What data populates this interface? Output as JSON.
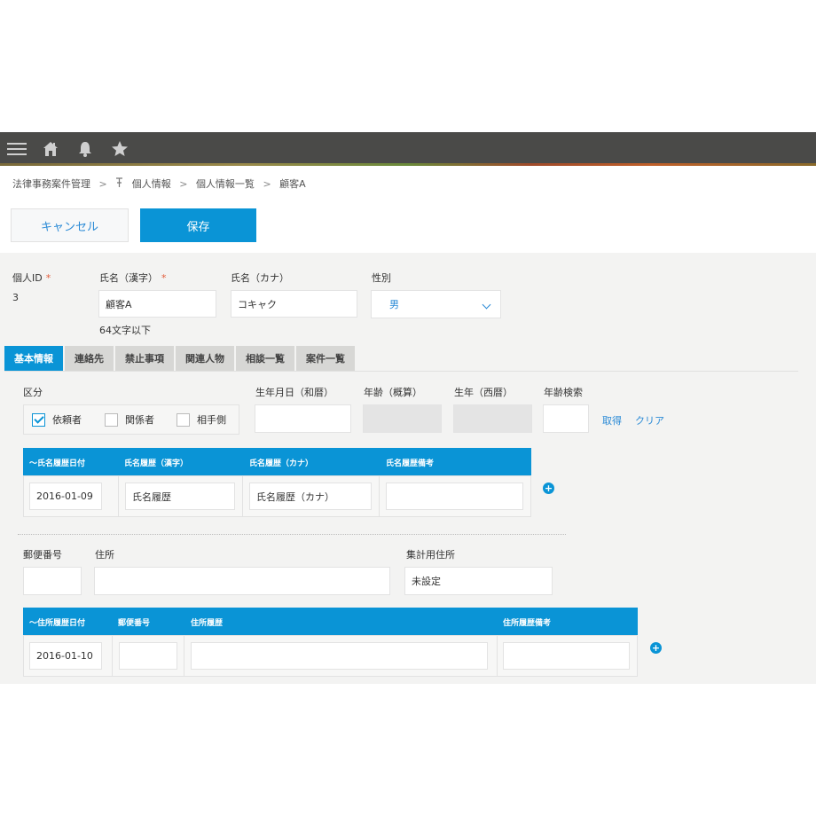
{
  "breadcrumb": {
    "app": "法律事務案件管理",
    "space": "個人情報",
    "view": "個人情報一覧",
    "record": "顧客A",
    "sep": ">"
  },
  "actions": {
    "cancel": "キャンセル",
    "save": "保存"
  },
  "header_fields": {
    "personal_id_label": "個人ID",
    "personal_id_value": "3",
    "required_mark": "*",
    "name_kanji_label": "氏名（漢字）",
    "name_kanji_value": "顧客A",
    "name_kanji_hint": "64文字以下",
    "name_kana_label": "氏名（カナ）",
    "name_kana_value": "コキャク",
    "gender_label": "性別",
    "gender_value": "男"
  },
  "tabs": [
    "基本情報",
    "連絡先",
    "禁止事項",
    "関連人物",
    "相談一覧",
    "案件一覧"
  ],
  "basic": {
    "category_label": "区分",
    "categories": [
      {
        "label": "依頼者",
        "checked": true
      },
      {
        "label": "関係者",
        "checked": false
      },
      {
        "label": "相手側",
        "checked": false
      }
    ],
    "birth_jp_label": "生年月日（和暦）",
    "age_label": "年齢（概算）",
    "birth_year_label": "生年（西暦）",
    "age_search_label": "年齢検索",
    "fetch_link": "取得",
    "clear_link": "クリア",
    "name_history": {
      "headers": [
        "〜氏名履歴日付",
        "氏名履歴（漢字）",
        "氏名履歴（カナ）",
        "氏名履歴備考"
      ],
      "row": [
        "2016-01-09",
        "氏名履歴",
        "氏名履歴（カナ）",
        ""
      ]
    },
    "postal_label": "郵便番号",
    "address_label": "住所",
    "agg_address_label": "集計用住所",
    "agg_address_value": "未設定",
    "address_history": {
      "headers": [
        "〜住所履歴日付",
        "郵便番号",
        "住所履歴",
        "住所履歴備考"
      ],
      "row": [
        "2016-01-10",
        "",
        "",
        ""
      ]
    }
  },
  "colors": {
    "accent": "#0a94d6",
    "topbar": "#4a4a48",
    "required": "#e25b3a"
  }
}
